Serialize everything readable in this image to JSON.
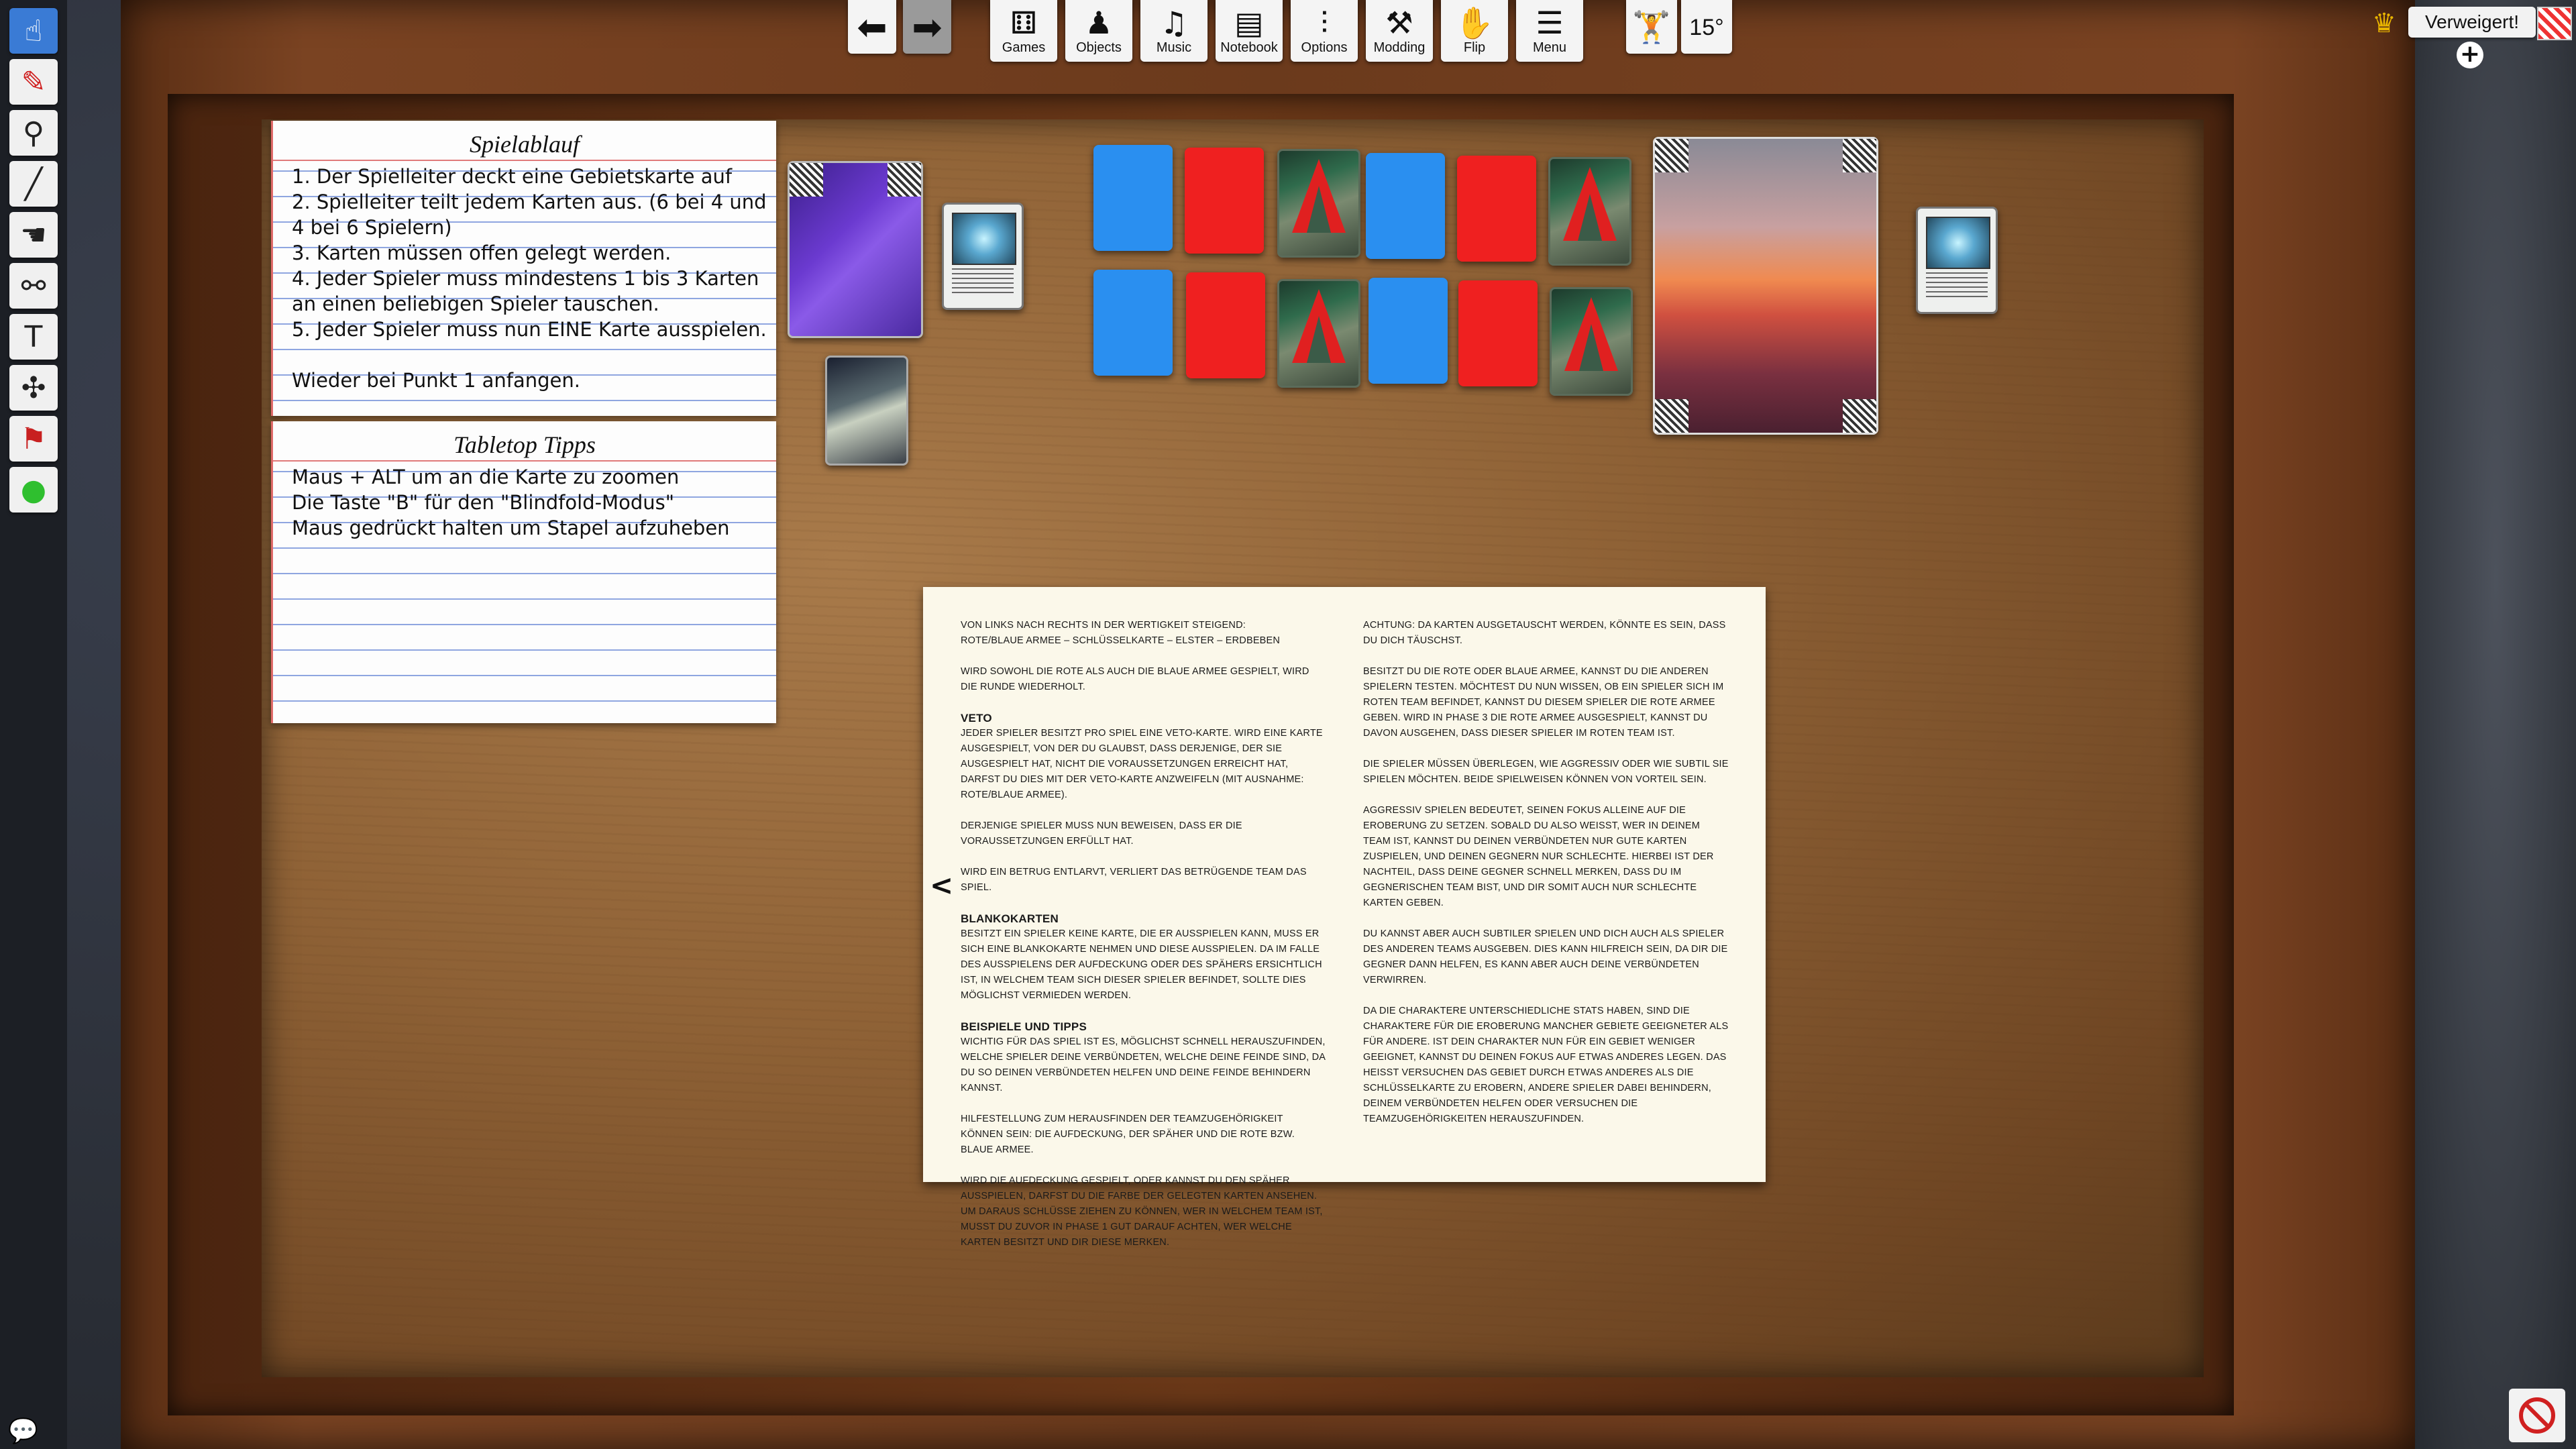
{
  "toolbar_left": {
    "tools": [
      {
        "icon": "pointer-hand-icon",
        "glyph": "☝",
        "active": true
      },
      {
        "icon": "pen-icon",
        "glyph": "✎"
      },
      {
        "icon": "location-pin-icon",
        "glyph": "⚲"
      },
      {
        "icon": "line-tool-icon",
        "glyph": "╱"
      },
      {
        "icon": "flick-hand-icon",
        "glyph": "☚"
      },
      {
        "icon": "joint-tool-icon",
        "glyph": "⚯"
      },
      {
        "icon": "text-tool-icon",
        "glyph": "T"
      },
      {
        "icon": "gizmo-icon",
        "glyph": "✣"
      },
      {
        "icon": "stamp-icon",
        "glyph": "⚑"
      },
      {
        "icon": "green-ball-icon",
        "glyph": "●"
      }
    ]
  },
  "toolbar_top": {
    "buttons": [
      {
        "label": "Games",
        "icon": "dice-icon",
        "glyph": "⚅"
      },
      {
        "label": "Objects",
        "icon": "pawn-icon",
        "glyph": "♟"
      },
      {
        "label": "Music",
        "icon": "speaker-icon",
        "glyph": "♫"
      },
      {
        "label": "Notebook",
        "icon": "notebook-icon",
        "glyph": "▤"
      },
      {
        "label": "Options",
        "icon": "sliders-icon",
        "glyph": "⫶"
      },
      {
        "label": "Modding",
        "icon": "tools-icon",
        "glyph": "⚒"
      },
      {
        "label": "Flip",
        "icon": "flip-hand-icon",
        "glyph": "✋"
      },
      {
        "label": "Menu",
        "icon": "hamburger-icon",
        "glyph": "☰"
      }
    ],
    "angle_label": "15°"
  },
  "status": {
    "denied_label": "Verweigert!"
  },
  "notecards": {
    "spielablauf": {
      "title": "Spielablauf",
      "lines": [
        "1. Der Spielleiter deckt eine Gebietskarte auf",
        "2. Spielleiter teilt jedem Karten aus. (6 bei 4 und",
        "4 bei 6 Spielern)",
        "3. Karten müssen offen gelegt werden.",
        "4. Jeder Spieler muss mindestens 1 bis 3 Karten",
        "an einen beliebigen Spieler tauschen.",
        "5. Jeder Spieler muss nun EINE Karte ausspielen.",
        "",
        "Wieder bei Punkt 1 anfangen."
      ]
    },
    "tipps": {
      "title": "Tabletop Tipps",
      "lines": [
        "Maus + ALT um an die Karte zu zoomen",
        "Die Taste \"B\" für den \"Blindfold-Modus\"",
        "Maus gedrückt halten um Stapel aufzuheben"
      ]
    }
  },
  "rulebook": {
    "left": [
      {
        "type": "p",
        "text": "Von links nach rechts in der Wertigkeit steigend:\nRote/Blaue Armee – Schlüsselkarte – Elster – Erdbeben"
      },
      {
        "type": "p",
        "text": "Wird sowohl die rote als auch die blaue Armee gespielt, wird die Runde wiederholt."
      },
      {
        "type": "h",
        "text": "Veto"
      },
      {
        "type": "p",
        "text": "Jeder Spieler besitzt pro Spiel eine Veto-Karte. Wird eine Karte ausgespielt, von der du glaubst, dass derjenige, der sie ausgespielt hat, nicht die Voraussetzungen erreicht hat, darfst du dies mit der Veto-Karte anzweifeln (mit Ausnahme: Rote/Blaue Armee)."
      },
      {
        "type": "p",
        "text": "Derjenige Spieler muss nun beweisen, dass er die Voraussetzungen erfüllt hat."
      },
      {
        "type": "p",
        "text": "Wird ein Betrug entlarvt, verliert das betrügende Team das Spiel."
      },
      {
        "type": "h",
        "text": "Blankokarten"
      },
      {
        "type": "p",
        "text": "Besitzt ein Spieler keine Karte, die er ausspielen kann, muss er sich eine Blankokarte nehmen und diese ausspielen. Da im Falle des Ausspielens der Aufdeckung oder des Spähers ersichtlich ist, in welchem Team sich dieser Spieler befindet, sollte dies möglichst vermieden werden."
      },
      {
        "type": "h",
        "text": "Beispiele und Tipps"
      },
      {
        "type": "p",
        "text": "Wichtig für das Spiel ist es, möglichst schnell herauszufinden, welche Spieler deine Verbündeten, welche deine Feinde sind, da du so deinen Verbündeten helfen und deine Feinde behindern kannst."
      },
      {
        "type": "p",
        "text": "Hilfestellung zum Herausfinden der Teamzugehörigkeit können sein: die Aufdeckung, der Späher und die rote bzw. blaue Armee."
      },
      {
        "type": "p",
        "text": "Wird die Aufdeckung gespielt, oder kannst du den Späher ausspielen, darfst du die Farbe der gelegten Karten ansehen. Um daraus Schlüsse ziehen zu können, wer in welchem Team ist, musst du zuvor in Phase 1 gut darauf achten, wer welche Karten besitzt und dir diese merken."
      }
    ],
    "right": [
      {
        "type": "p",
        "text": "Achtung: Da Karten ausgetauscht werden, könnte es sein, dass du dich täuschst."
      },
      {
        "type": "p",
        "text": "Besitzt du die rote oder blaue Armee, kannst du die anderen Spielern testen. Möchtest du nun wissen, ob ein Spieler sich im roten Team befindet, kannst du diesem Spieler die rote Armee geben. Wird in Phase 3 die rote Armee ausgespielt, kannst du davon ausgehen, dass dieser Spieler im roten Team ist."
      },
      {
        "type": "p",
        "text": "Die Spieler müssen überlegen, wie aggressiv oder wie subtil sie spielen möchten. Beide Spielweisen können von Vorteil sein."
      },
      {
        "type": "p",
        "text": "Aggressiv spielen bedeutet, seinen Fokus alleine auf die Eroberung zu setzen. Sobald du also weisst, wer in deinem Team ist, kannst du deinen Verbündeten nur gute Karten zuspielen, und deinen Gegnern nur schlechte. Hierbei ist der Nachteil, dass deine Gegner schnell merken, dass du im gegnerischen Team bist, und dir somit auch nur schlechte Karten geben."
      },
      {
        "type": "p",
        "text": "Du kannst aber auch subtiler spielen und dich auch als Spieler des anderen Teams ausgeben. Dies kann hilfreich sein, da dir die Gegner dann helfen, es kann aber auch deine Verbündeten verwirren."
      },
      {
        "type": "p",
        "text": "Da die Charaktere unterschiedliche Stats haben, sind die Charaktere für die Eroberung mancher Gebiete geeigneter als für andere. Ist dein Charakter nun für ein Gebiet weniger geeignet, kannst du deinen Fokus auf etwas anderes legen. Das heisst versuchen das Gebiet durch etwas anderes als die Schlüsselkarte zu erobern, andere Spieler dabei behindern, deinem Verbündeten helfen oder versuchen die Teamzugehörigkeiten herauszufinden."
      }
    ]
  },
  "colors": {
    "blue_card": "#2a8ff0",
    "red_card": "#ef2020",
    "accent_tool": "#3a7bd5"
  }
}
